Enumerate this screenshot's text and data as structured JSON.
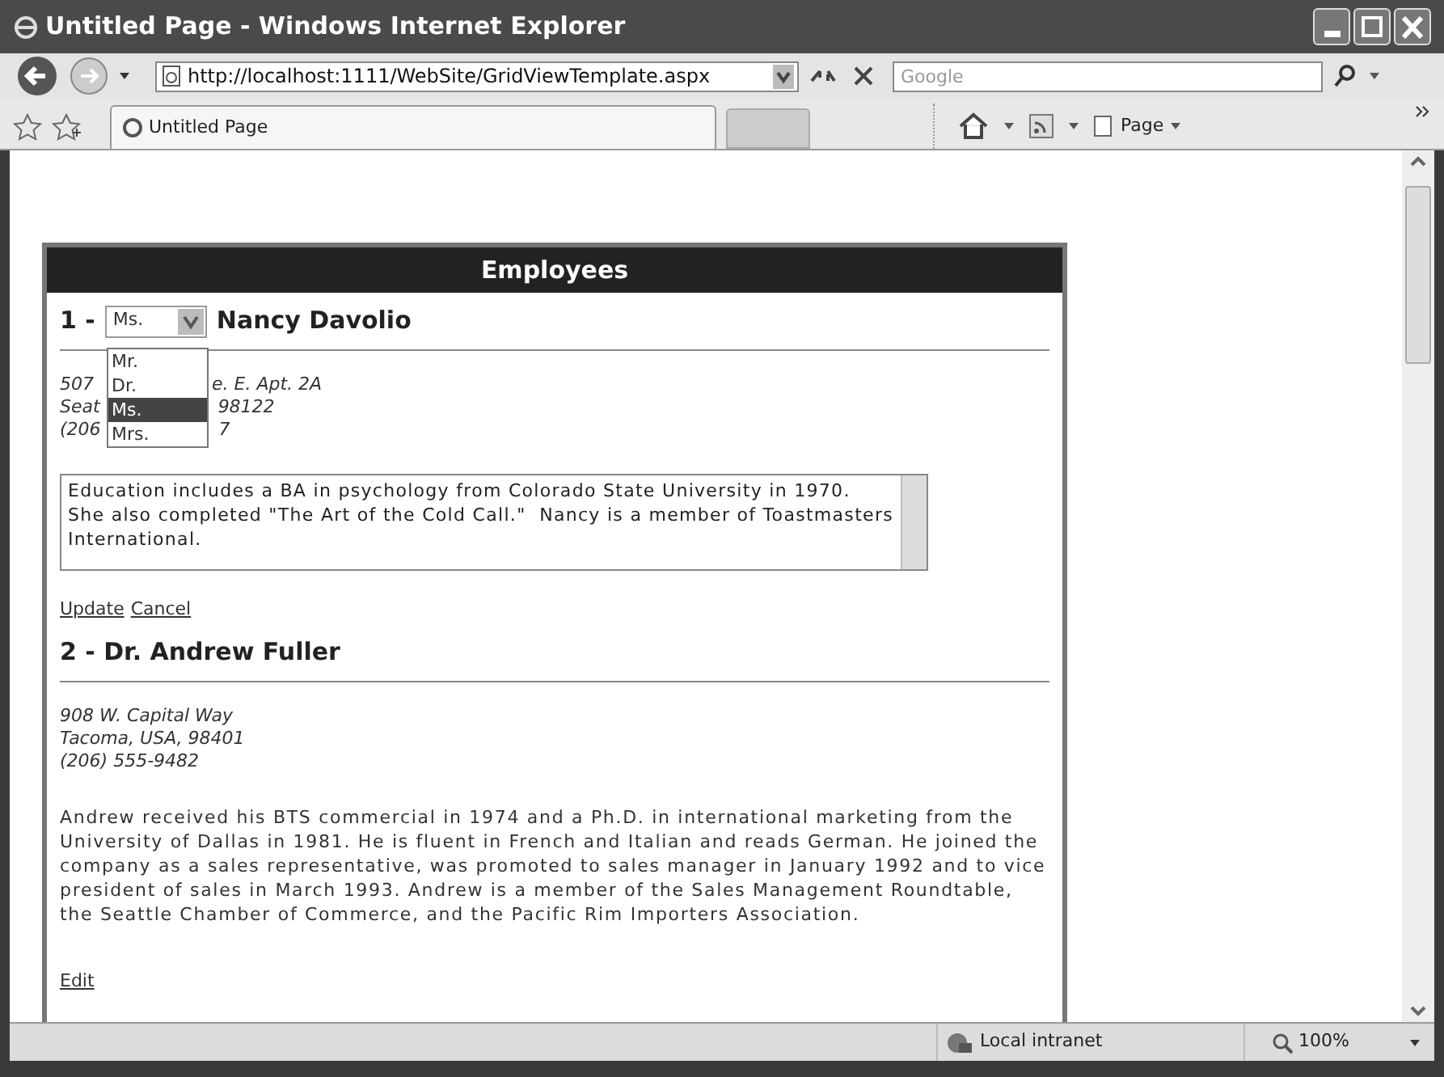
{
  "window": {
    "title": "Untitled Page - Windows Internet Explorer"
  },
  "address_bar": {
    "url": "http://localhost:1111/WebSite/GridViewTemplate.aspx"
  },
  "search": {
    "placeholder": "Google"
  },
  "tabs": [
    {
      "label": "Untitled Page",
      "selected": true
    }
  ],
  "command_bar": {
    "page_menu": "Page"
  },
  "grid": {
    "header": "Employees",
    "rows": [
      {
        "kind": "edit",
        "number": "1 -",
        "name": "Nancy Davolio",
        "title_select": {
          "value": "Ms.",
          "expanded": true,
          "options": [
            {
              "label": "Mr.",
              "selected": false
            },
            {
              "label": "Dr.",
              "selected": false
            },
            {
              "label": "Ms.",
              "selected": true
            },
            {
              "label": "Mrs.",
              "selected": false
            }
          ]
        },
        "address_lines": [
          [
            "507",
            "e. E. Apt. 2A"
          ],
          [
            "Seat",
            "98122"
          ],
          [
            "(206",
            "7"
          ]
        ],
        "notes": "Education includes a BA in psychology from Colorado State University in 1970.  She also completed \"The Art of the Cold Call.\"  Nancy is a member of Toastmasters International.",
        "links": [
          "Update",
          "Cancel"
        ]
      },
      {
        "kind": "view",
        "heading": "2 - Dr. Andrew Fuller",
        "address_lines": [
          [
            "908 W. Capital Way"
          ],
          [
            "Tacoma, USA, 98401"
          ],
          [
            "(206) 555-9482"
          ]
        ],
        "notes": "Andrew received his BTS commercial in 1974 and a Ph.D. in international marketing from the University of Dallas in 1981. He is fluent in French and Italian and reads German. He joined the company as a sales representative, was promoted to sales manager in January 1992 and to vice president of sales in March 1993. Andrew is a member of the Sales Management Roundtable, the Seattle Chamber of Commerce, and the Pacific Rim Importers Association.",
        "links": [
          "Edit"
        ]
      }
    ]
  },
  "status_bar": {
    "zone": "Local intranet",
    "zoom": "100%"
  }
}
